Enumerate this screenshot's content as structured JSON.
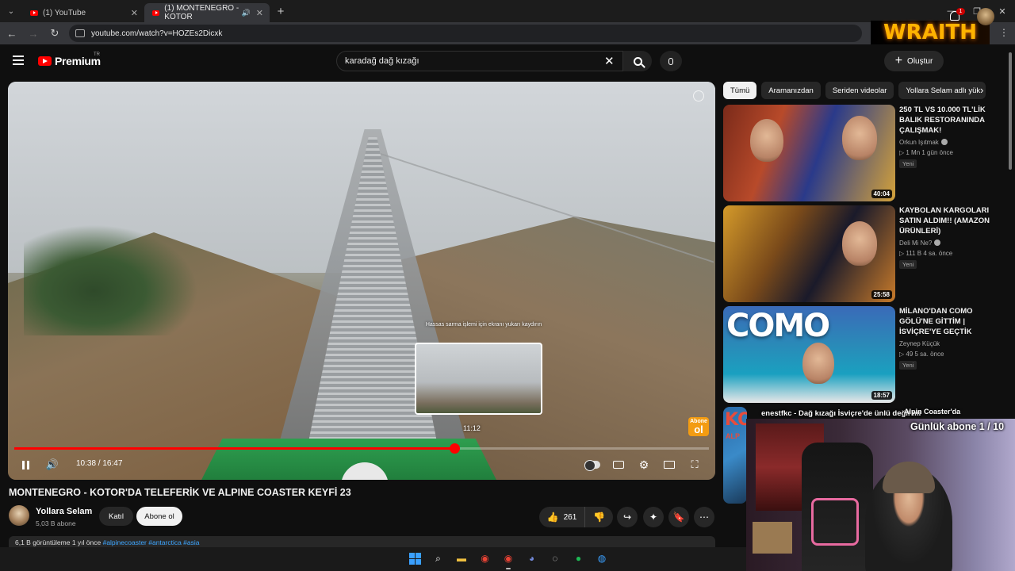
{
  "browser": {
    "tabs": [
      {
        "title": "(1) YouTube"
      },
      {
        "title": "(1) MONTENEGRO - KOTOR"
      }
    ],
    "url": "youtube.com/watch?v=HOZEs2Dicxk"
  },
  "stream_overlay": {
    "brand": "WRAITH",
    "chat_line": "enestfkc - Dağ kızağı İsviçre'de ünlü değil mi",
    "chat_line2": "Alpin Coaster'da",
    "counter": "Günlük abone 1 / 10"
  },
  "youtube": {
    "logo_text": "Premium",
    "logo_region": "TR",
    "search_query": "karadağ dağ kızağı",
    "create_label": "Oluştur",
    "notification_count": "1"
  },
  "player": {
    "hint": "Hassas sarma işlemi için ekranı yukarı kaydırın",
    "preview_time": "11:12",
    "current_time": "10:38",
    "duration": "16:47",
    "progress": 0.634,
    "badge_line1": "Abone",
    "badge_line2": "ol"
  },
  "video": {
    "title": "MONTENEGRO - KOTOR'DA TELEFERİK VE ALPINE COASTER KEYFİ 23",
    "channel": "Yollara Selam",
    "subscribers": "5,03 B abone",
    "join_label": "Katıl",
    "subscribe_label": "Abone ol",
    "likes": "261",
    "desc_stats": "6,1 B görüntüleme  1 yıl önce",
    "desc_tags": "#alpinecoaster #antarctica #asia"
  },
  "sidebar": {
    "chips": [
      "Tümü",
      "Aramanızdan",
      "Seriden videolar",
      "Yollara Selam adlı yük"
    ],
    "recs": [
      {
        "title": "250 TL VS 10.000 TL'LİK BALIK RESTORANINDA ÇALIŞMAK!",
        "channel": "Orkun Işıtmak",
        "meta": "▷ 1 Mn  1 gün önce",
        "new": "Yeni",
        "duration": "40:04"
      },
      {
        "title": "KAYBOLAN KARGOLARI SATIN ALDIM!! (AMAZON ÜRÜNLERİ)",
        "channel": "Deli Mi Ne?",
        "meta": "▷ 111 B  4 sa. önce",
        "new": "Yeni",
        "duration": "25:58"
      },
      {
        "title": "MİLANO'DAN COMO GÖLÜ'NE GİTTİM | İSVİÇRE'YE GEÇTİK",
        "channel": "Zeynep Küçük",
        "meta": "▷ 49  5 sa. önce",
        "new": "Yeni",
        "duration": "18:57",
        "thumb_text": "COMO"
      },
      {
        "thumb_text": "KO",
        "thumb_subtext": "ALP"
      }
    ]
  },
  "colors": {
    "accent": "#ff0000",
    "background": "#0f0f0f",
    "chip_bg": "#272727"
  }
}
